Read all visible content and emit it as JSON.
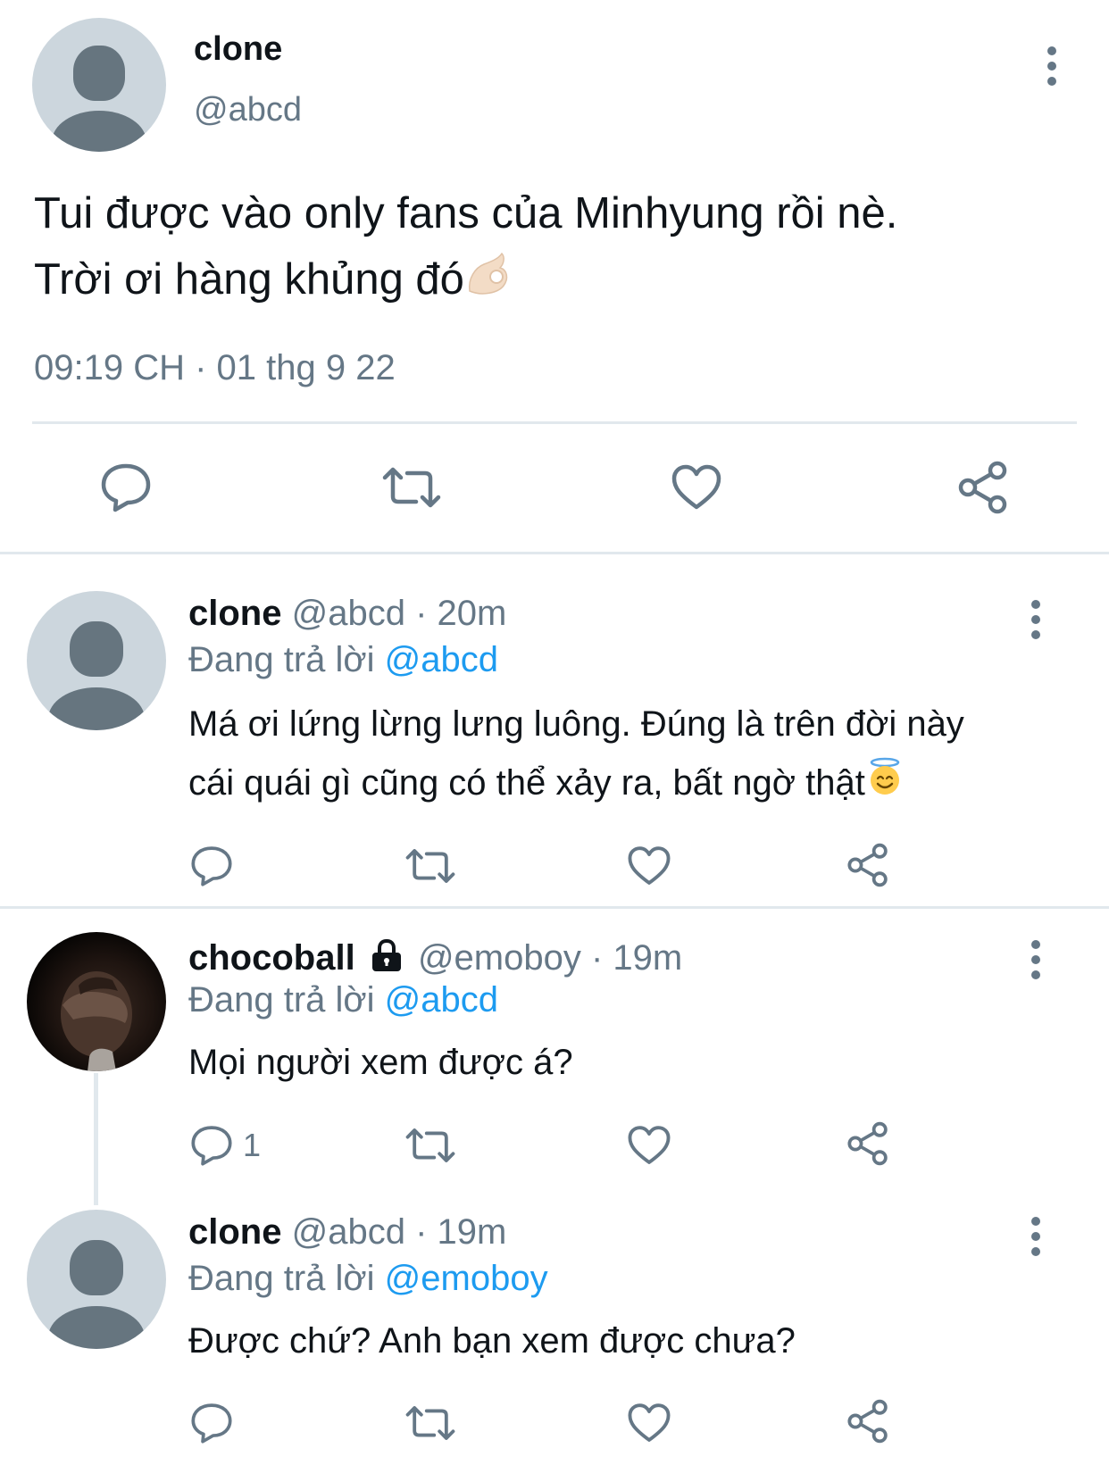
{
  "main_tweet": {
    "display_name": "clone",
    "handle": "@abcd",
    "text_line1": "Tui được vào only fans của Minhyung rồi nè.",
    "text_line2": "Trời ơi hàng khủng đó",
    "timestamp": "09:19 CH · 01 thg 9 22",
    "actions": [
      "reply-icon",
      "retweet-icon",
      "like-icon",
      "share-icon"
    ]
  },
  "replies": [
    {
      "display_name": "clone",
      "meta": "@abcd · 20m",
      "replying_prefix": "Đang trả lời",
      "replying_to": "@abcd",
      "text_line1": "Má ơi lứng lừng lưng luông. Đúng là trên đời này",
      "text_line2": "cái quái gì cũng có thể xảy ra, bất ngờ thật",
      "reply_count": ""
    },
    {
      "display_name": "chocoball",
      "meta": "@emoboy · 19m",
      "replying_prefix": "Đang trả lời",
      "replying_to": "@abcd",
      "text_line1": "Mọi người xem được á?",
      "reply_count": "1",
      "locked": true
    },
    {
      "display_name": "clone",
      "meta": "@abcd · 19m",
      "replying_prefix": "Đang trả lời",
      "replying_to": "@emoboy",
      "text_line1": "Được chứ? Anh bạn xem được chưa?",
      "reply_count": ""
    }
  ],
  "colors": {
    "text": "#0f1419",
    "muted": "#657786",
    "link": "#1d9bf0",
    "divider": "#e1e8ed",
    "avatar_bg": "#ccd6dd",
    "avatar_fg": "#66757f"
  }
}
